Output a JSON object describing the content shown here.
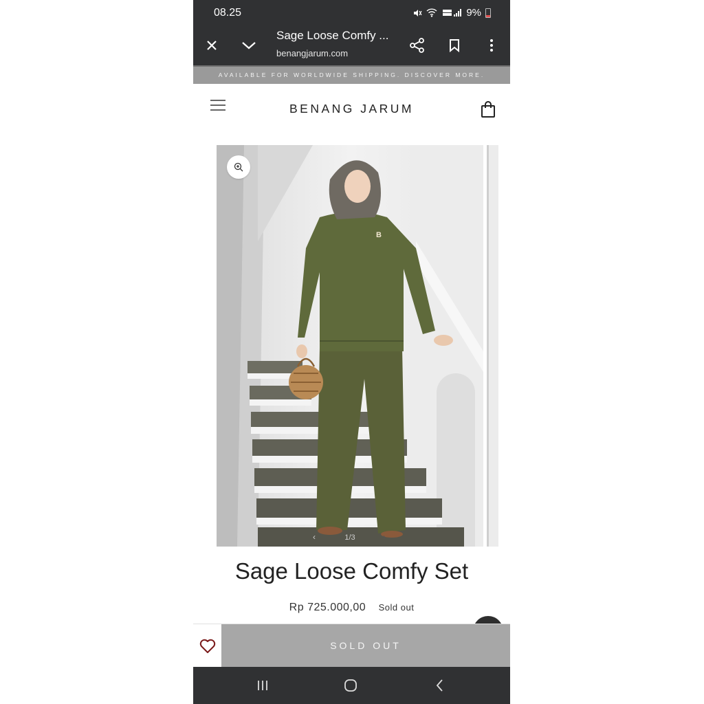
{
  "status_bar": {
    "time": "08.25",
    "battery": "9%"
  },
  "toolbar": {
    "title": "Sage Loose Comfy ...",
    "url": "benangjarum.com"
  },
  "announcement": "AVAILABLE FOR WORLDWIDE SHIPPING. DISCOVER MORE.",
  "header": {
    "brand": "BENANG JARUM"
  },
  "gallery": {
    "counter": "1/3",
    "logo_letter": "B"
  },
  "product": {
    "title": "Sage Loose Comfy Set",
    "price": "Rp 725.000,00",
    "badge": "Sold out"
  },
  "bottom_bar": {
    "button_label": "SOLD OUT"
  },
  "icons": {
    "close": "close-icon",
    "collapse": "chevron-down-icon",
    "share": "share-icon",
    "bookmark": "bookmark-icon",
    "more": "more-vertical-icon",
    "menu": "hamburger-menu-icon",
    "bag": "shopping-bag-icon",
    "zoom": "zoom-in-icon",
    "favorite": "heart-icon",
    "chat": "chat-bubble-icon",
    "recents": "recent-apps-icon",
    "home": "home-icon",
    "back": "back-icon"
  },
  "colors": {
    "chrome": "#303133",
    "announcement_bg": "#9a9a9a",
    "sold_out_bg": "#a7a7a7",
    "heart": "#7a1a1a"
  }
}
